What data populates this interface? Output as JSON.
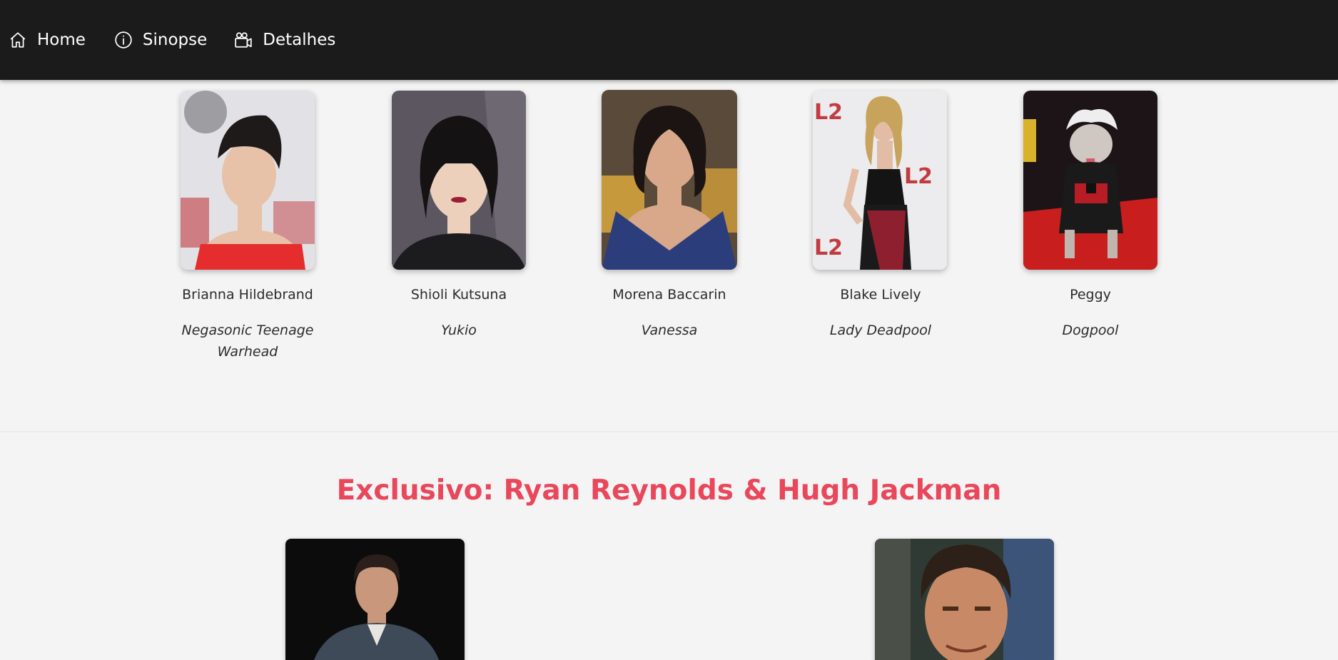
{
  "nav": {
    "home": "Home",
    "sinopse": "Sinopse",
    "detalhes": "Detalhes"
  },
  "cast": [
    {
      "actor": "Brianna Hildebrand",
      "role": "Negasonic Teenage Warhead"
    },
    {
      "actor": "Shioli Kutsuna",
      "role": "Yukio"
    },
    {
      "actor": "Morena Baccarin",
      "role": "Vanessa"
    },
    {
      "actor": "Blake Lively",
      "role": "Lady Deadpool"
    },
    {
      "actor": "Peggy",
      "role": "Dogpool"
    }
  ],
  "exclusive": {
    "title": "Exclusivo: Ryan Reynolds & Hugh Jackman"
  },
  "colors": {
    "navbar_bg": "#1b1b1b",
    "page_bg": "#f4f4f4",
    "accent": "#e9475b"
  },
  "icons": {
    "home": "home-icon",
    "sinopse": "info-circle-icon",
    "detalhes": "camera-video-icon"
  }
}
